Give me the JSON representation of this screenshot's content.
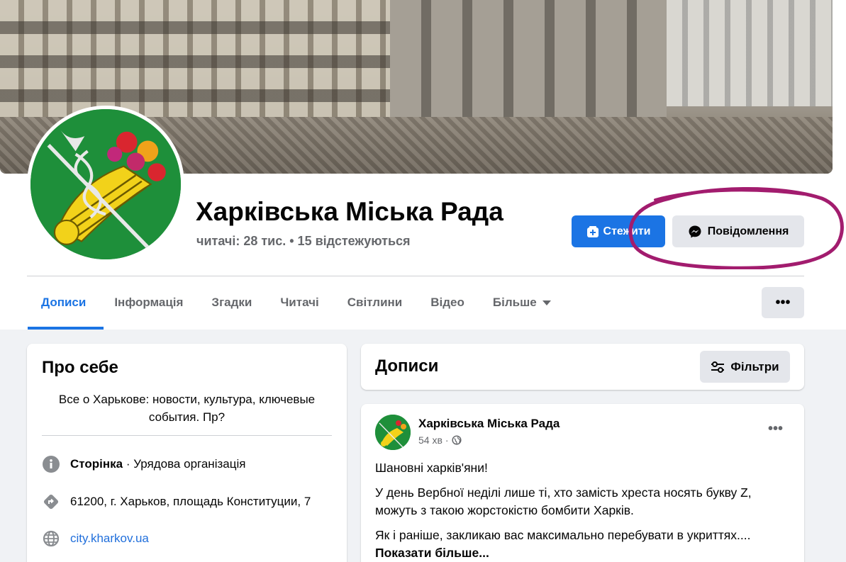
{
  "page": {
    "name": "Харківська Міська Рада",
    "stats": "читачі: 28 тис. • 15 відстежуються"
  },
  "actions": {
    "follow_label": "Стежити",
    "message_label": "Повідомлення"
  },
  "tabs": [
    {
      "label": "Дописи",
      "active": true
    },
    {
      "label": "Інформація"
    },
    {
      "label": "Згадки"
    },
    {
      "label": "Читачі"
    },
    {
      "label": "Світлини"
    },
    {
      "label": "Відео"
    },
    {
      "label": "Більше"
    }
  ],
  "more_button": "•••",
  "about": {
    "title": "Про себе",
    "description": "Все о Харькове: новости, культура, ключевые события. Пр?",
    "category_label": "Сторінка",
    "category_value": " · Урядова організація",
    "address": "61200, г. Харьков, площадь Конституции, 7",
    "website": "city.kharkov.ua"
  },
  "posts_section": {
    "title": "Дописи",
    "filter_label": "Фільтри"
  },
  "post": {
    "author": "Харківська Міська Рада",
    "time": "54 хв",
    "dot": "·",
    "menu": "•••",
    "greeting": "Шановні харків'яни!",
    "paragraph1": "У день Вербної неділі лише ті, хто замість хреста носять букву Z, можуть з такою жорстокістю бомбити Харків.",
    "paragraph2": "Як і раніше, закликаю вас максимально перебувати в укриттях....",
    "show_more": "Показати більше..."
  },
  "colors": {
    "accent": "#1b74e4",
    "annotation": "#a21c6e",
    "background": "#f0f2f5"
  }
}
